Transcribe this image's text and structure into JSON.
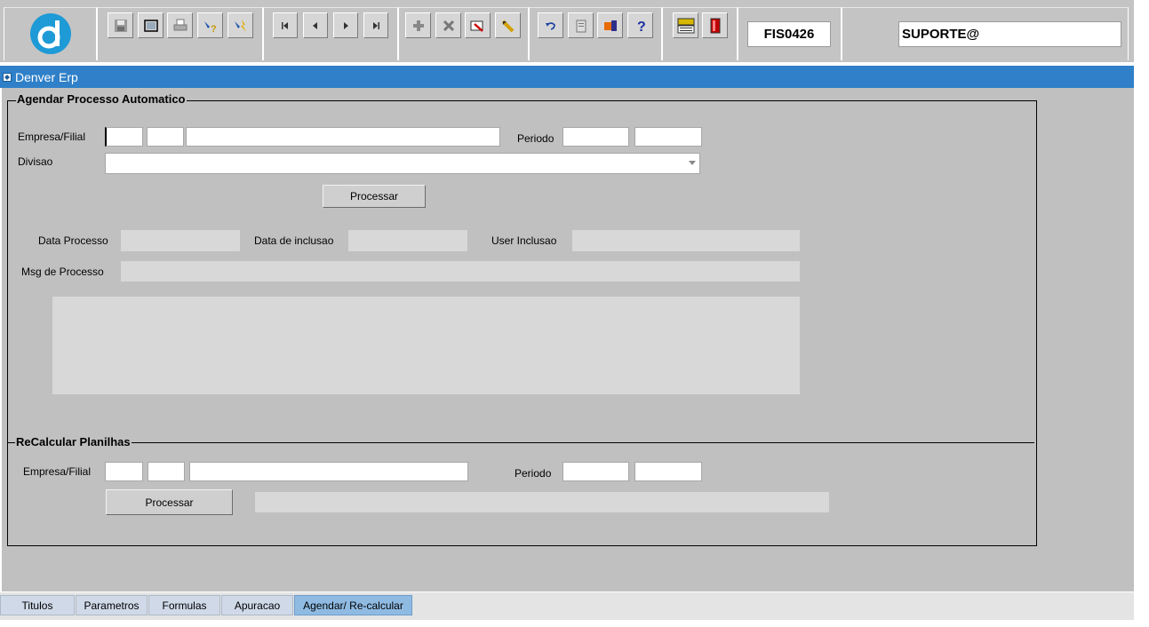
{
  "toolbar": {
    "form_code": "FIS0426",
    "user": "SUPORTE@",
    "icons": [
      "save-icon",
      "window-icon",
      "print-icon",
      "help-query-icon",
      "execute-query-icon",
      "first-record-icon",
      "prev-record-icon",
      "next-record-icon",
      "last-record-icon",
      "insert-record-icon",
      "delete-record-icon",
      "edit-record-icon",
      "clear-record-icon",
      "undo-icon",
      "clipboard-icon",
      "list-icon",
      "question-icon",
      "menu-icon",
      "exit-icon"
    ]
  },
  "window": {
    "title": "Denver Erp"
  },
  "agendar": {
    "title": "Agendar Processo Automatico",
    "empresa_label": "Empresa/Filial",
    "periodo_label": "Periodo",
    "divisao_label": "Divisao",
    "processar_label": "Processar",
    "data_processo_label": "Data Processo",
    "data_inclusao_label": "Data de inclusao",
    "user_inclusao_label": "User Inclusao",
    "msg_processo_label": "Msg de Processo"
  },
  "recalcular": {
    "title": "ReCalcular Planilhas",
    "empresa_label": "Empresa/Filial",
    "periodo_label": "Periodo",
    "processar_label": "Processar"
  },
  "tabs": [
    {
      "label": "Titulos"
    },
    {
      "label": "Parametros"
    },
    {
      "label": "Formulas"
    },
    {
      "label": "Apuracao"
    },
    {
      "label": "Agendar/ Re-calcular"
    }
  ],
  "colors": {
    "titlebar": "#2f80c8",
    "canvas": "#c0c0c0",
    "active_tab": "#8fbbe3"
  }
}
